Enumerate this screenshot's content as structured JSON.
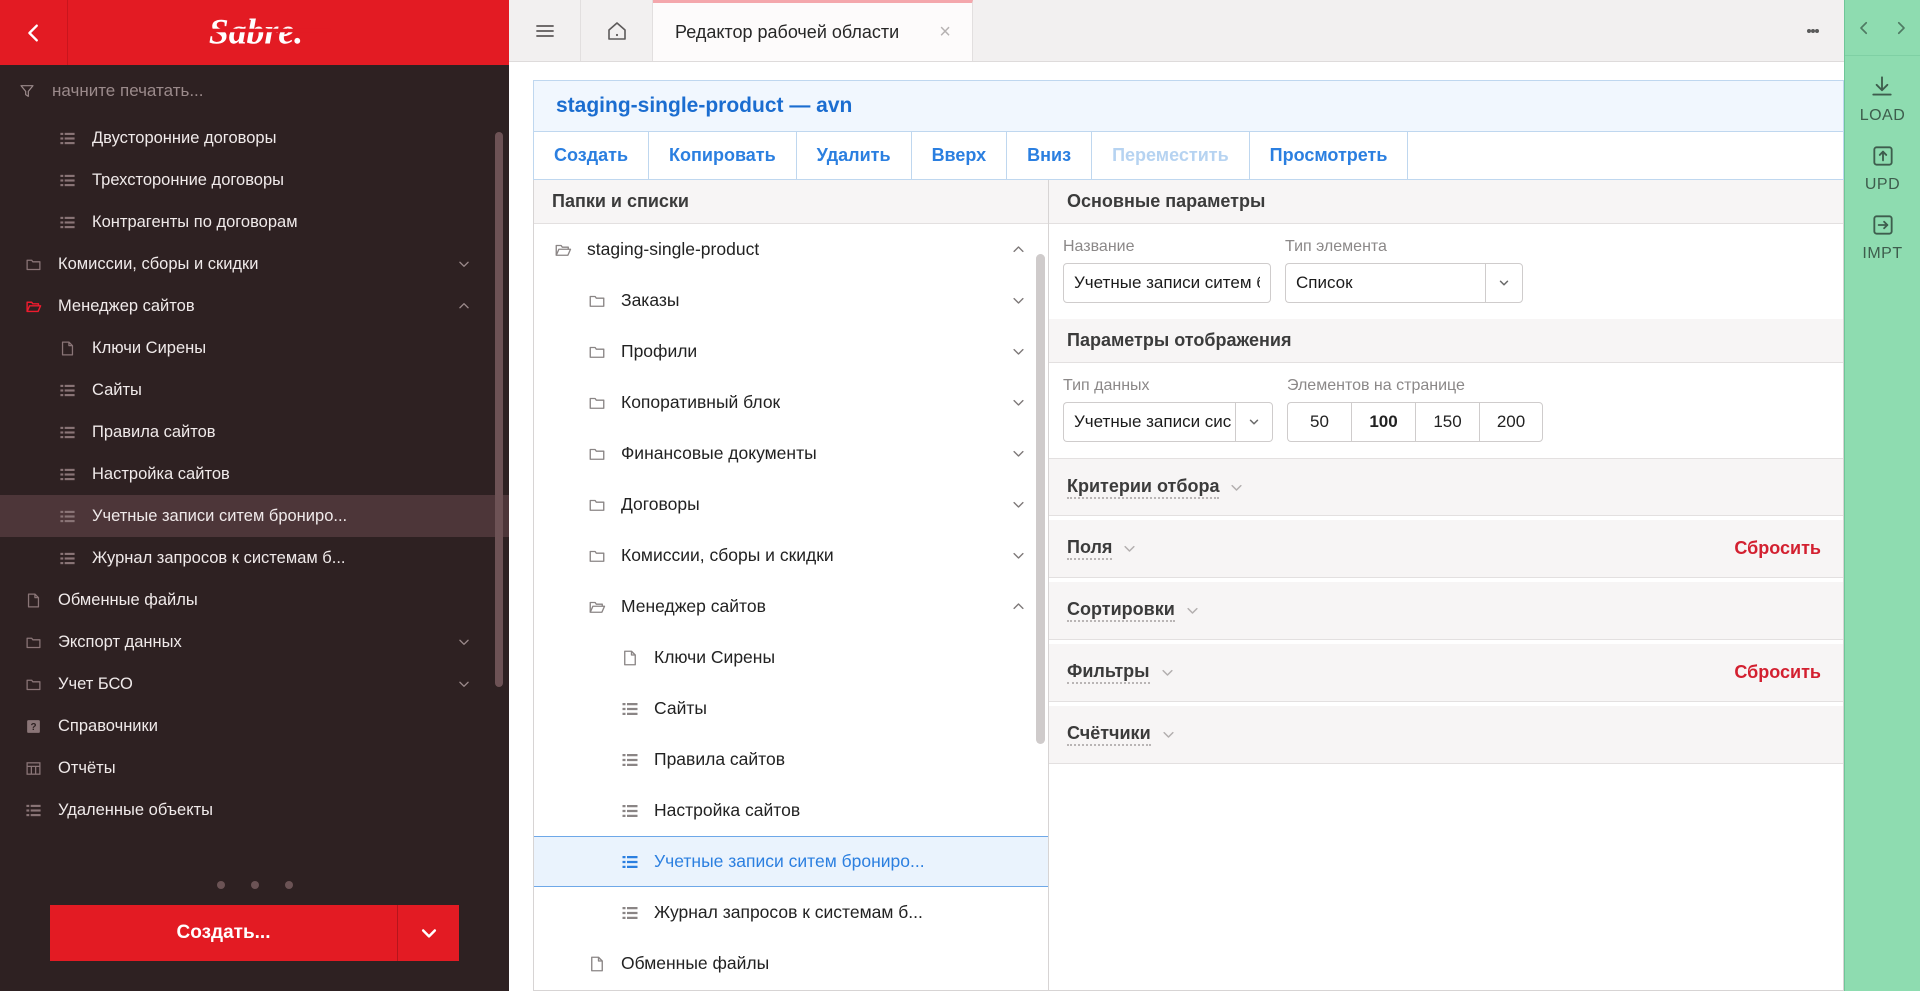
{
  "sidebar": {
    "back_icon": "chevron-left-icon",
    "logo_text": "Sabre.",
    "filter_placeholder": "начните печатать...",
    "filter_value": "",
    "items": [
      {
        "label": "Двусторонние договоры",
        "icon": "list-icon",
        "level": 2,
        "chevron": "",
        "selected": false
      },
      {
        "label": "Трехсторонние договоры",
        "icon": "list-icon",
        "level": 2,
        "chevron": "",
        "selected": false
      },
      {
        "label": "Контрагенты по договорам",
        "icon": "list-icon",
        "level": 2,
        "chevron": "",
        "selected": false
      },
      {
        "label": "Комиссии, сборы и скидки",
        "icon": "folder-icon",
        "level": 1,
        "chevron": "down",
        "selected": false
      },
      {
        "label": "Менеджер сайтов",
        "icon": "folder-open-red-icon",
        "level": 1,
        "chevron": "up",
        "selected": false
      },
      {
        "label": "Ключи Сирены",
        "icon": "file-icon",
        "level": 2,
        "chevron": "",
        "selected": false
      },
      {
        "label": "Сайты",
        "icon": "list-icon",
        "level": 2,
        "chevron": "",
        "selected": false
      },
      {
        "label": "Правила сайтов",
        "icon": "list-icon",
        "level": 2,
        "chevron": "",
        "selected": false
      },
      {
        "label": "Настройка сайтов",
        "icon": "list-icon",
        "level": 2,
        "chevron": "",
        "selected": false
      },
      {
        "label": "Учетные записи ситем брониро...",
        "icon": "list-icon",
        "level": 2,
        "chevron": "",
        "selected": true
      },
      {
        "label": "Журнал запросов к системам б...",
        "icon": "list-icon",
        "level": 2,
        "chevron": "",
        "selected": false
      },
      {
        "label": "Обменные файлы",
        "icon": "file-icon",
        "level": 1,
        "chevron": "",
        "selected": false
      },
      {
        "label": "Экспорт данных",
        "icon": "folder-icon",
        "level": 1,
        "chevron": "down",
        "selected": false
      },
      {
        "label": "Учет БСО",
        "icon": "folder-icon",
        "level": 1,
        "chevron": "down",
        "selected": false
      },
      {
        "label": "Справочники",
        "icon": "help-book-icon",
        "level": 1,
        "chevron": "",
        "selected": false
      },
      {
        "label": "Отчёты",
        "icon": "reports-icon",
        "level": 1,
        "chevron": "",
        "selected": false
      },
      {
        "label": "Удаленные объекты",
        "icon": "list-icon",
        "level": 1,
        "chevron": "",
        "selected": false
      }
    ],
    "create_button": "Создать...",
    "create_caret_icon": "chevron-down-icon"
  },
  "tabbar": {
    "menu_icon": "hamburger-icon",
    "home_icon": "home-icon",
    "kebab_icon": "kebab-menu-icon",
    "tabs": [
      {
        "label": "Редактор рабочей области",
        "close": "×",
        "active": true
      }
    ]
  },
  "editor": {
    "title": "staging-single-product — avn",
    "toolbar": [
      {
        "label": "Создать",
        "disabled": false
      },
      {
        "label": "Копировать",
        "disabled": false
      },
      {
        "label": "Удалить",
        "disabled": false
      },
      {
        "label": "Вверх",
        "disabled": false
      },
      {
        "label": "Вниз",
        "disabled": false
      },
      {
        "label": "Переместить",
        "disabled": true
      },
      {
        "label": "Просмотреть",
        "disabled": false
      }
    ]
  },
  "tree_panel": {
    "header": "Папки и списки",
    "nodes": [
      {
        "label": "staging-single-product",
        "icon": "folder-open-icon",
        "depth": 0,
        "chevron": "up",
        "selected": false
      },
      {
        "label": "Заказы",
        "icon": "folder-icon",
        "depth": 1,
        "chevron": "down",
        "selected": false
      },
      {
        "label": "Профили",
        "icon": "folder-icon",
        "depth": 1,
        "chevron": "down",
        "selected": false
      },
      {
        "label": "Копоративный блок",
        "icon": "folder-icon",
        "depth": 1,
        "chevron": "down",
        "selected": false
      },
      {
        "label": "Финансовые документы",
        "icon": "folder-icon",
        "depth": 1,
        "chevron": "down",
        "selected": false
      },
      {
        "label": "Договоры",
        "icon": "folder-icon",
        "depth": 1,
        "chevron": "down",
        "selected": false
      },
      {
        "label": "Комиссии, сборы и скидки",
        "icon": "folder-icon",
        "depth": 1,
        "chevron": "down",
        "selected": false
      },
      {
        "label": "Менеджер сайтов",
        "icon": "folder-open-icon",
        "depth": 1,
        "chevron": "up",
        "selected": false
      },
      {
        "label": "Ключи Сирены",
        "icon": "file-icon",
        "depth": 2,
        "chevron": "",
        "selected": false
      },
      {
        "label": "Сайты",
        "icon": "list-icon",
        "depth": 2,
        "chevron": "",
        "selected": false
      },
      {
        "label": "Правила сайтов",
        "icon": "list-icon",
        "depth": 2,
        "chevron": "",
        "selected": false
      },
      {
        "label": "Настройка сайтов",
        "icon": "list-icon",
        "depth": 2,
        "chevron": "",
        "selected": false
      },
      {
        "label": "Учетные записи ситем брониро...",
        "icon": "list-icon",
        "depth": 2,
        "chevron": "",
        "selected": true
      },
      {
        "label": "Журнал запросов к системам б...",
        "icon": "list-icon",
        "depth": 2,
        "chevron": "",
        "selected": false
      },
      {
        "label": "Обменные файлы",
        "icon": "file-icon",
        "depth": 1,
        "chevron": "",
        "selected": false
      }
    ]
  },
  "props": {
    "main_section_title": "Основные параметры",
    "name_label": "Название",
    "name_value": "Учетные записи ситем б",
    "type_label": "Тип элемента",
    "type_value": "Список",
    "display_section_title": "Параметры отображения",
    "data_type_label": "Тип данных",
    "data_type_value": "Учетные записи сис",
    "page_size_label": "Элементов на странице",
    "page_sizes": [
      "50",
      "100",
      "150",
      "200"
    ],
    "page_size_active": "100",
    "accordions": [
      {
        "title": "Критерии отбора",
        "reset": ""
      },
      {
        "title": "Поля",
        "reset": "Сбросить"
      },
      {
        "title": "Сортировки",
        "reset": ""
      },
      {
        "title": "Фильтры",
        "reset": "Сбросить"
      },
      {
        "title": "Счётчики",
        "reset": ""
      }
    ]
  },
  "rail": {
    "prev_icon": "chevron-left-icon",
    "next_icon": "chevron-right-icon",
    "items": [
      {
        "icon": "download-icon",
        "label": "LOAD"
      },
      {
        "icon": "upload-update-icon",
        "label": "UPD"
      },
      {
        "icon": "import-icon",
        "label": "IMPT"
      }
    ]
  },
  "colors": {
    "brand_red": "#e31b23",
    "sidebar_bg": "#2e2122",
    "accent_blue": "#2b7fe0",
    "reset_red": "#d32030",
    "rail_green": "#8edcb0"
  }
}
